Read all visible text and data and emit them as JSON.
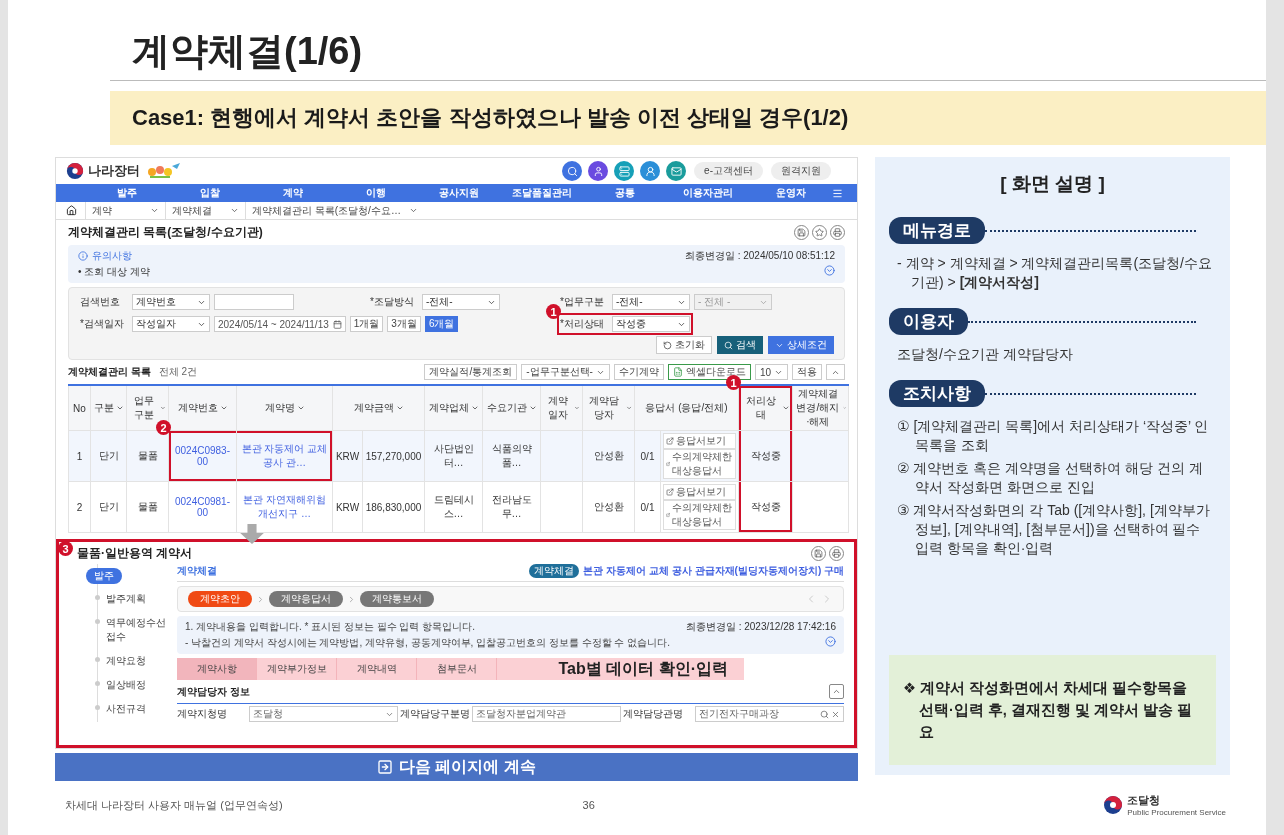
{
  "slide": {
    "title": "계약체결(1/6)",
    "case_title": "Case1: 현행에서 계약서 초안을 작성하였으나 발송 이전 상태일 경우(1/2)"
  },
  "app": {
    "logo": "나라장터",
    "header_buttons": [
      "e-고객센터",
      "원격지원"
    ],
    "nav": [
      "발주",
      "입찰",
      "계약",
      "이행",
      "공사지원",
      "조달품질관리",
      "공통",
      "이용자관리",
      "운영자"
    ],
    "breadcrumb": [
      "계약",
      "계약체결",
      "계약체결관리 목록(조달청/수요…"
    ],
    "page_title": "계약체결관리 목록(조달청/수요기관)",
    "notice": {
      "title": "유의사항",
      "item": "• 조회 대상 계약",
      "updated": "최종변경일 : 2024/05/10 08:51:12"
    },
    "search": {
      "fields": [
        {
          "label": "검색번호",
          "highlighted": false,
          "controls": [
            {
              "kind": "select",
              "value": "계약번호",
              "disabled": false
            },
            {
              "kind": "input"
            }
          ]
        },
        {
          "label": "*조달방식",
          "highlighted": false,
          "controls": [
            {
              "kind": "select",
              "value": "-전체-",
              "disabled": false
            }
          ]
        },
        {
          "label": "*업무구분",
          "highlighted": false,
          "controls": [
            {
              "kind": "select",
              "value": "-전체-",
              "disabled": false
            },
            {
              "kind": "select",
              "value": "- 전체 -",
              "disabled": true
            }
          ]
        },
        {
          "label": "*검색일자",
          "highlighted": false,
          "controls": [
            {
              "kind": "select",
              "value": "작성일자",
              "disabled": false
            },
            {
              "kind": "daterange",
              "value": "2024/05/14 ~ 2024/11/13"
            },
            {
              "kind": "period",
              "options": [
                {
                  "label": "1개월",
                  "selected": false
                },
                {
                  "label": "3개월",
                  "selected": false
                },
                {
                  "label": "6개월",
                  "selected": true
                }
              ]
            }
          ]
        },
        {
          "label": "*처리상태",
          "highlighted": true,
          "marker": "1",
          "controls": [
            {
              "kind": "select",
              "value": "작성중",
              "disabled": false
            }
          ]
        }
      ],
      "buttons": [
        {
          "kind": "reset",
          "label": "초기화"
        },
        {
          "kind": "search",
          "label": "검색"
        },
        {
          "kind": "detail",
          "label": "상세조건"
        }
      ]
    },
    "list": {
      "title": "계약체결관리 목록",
      "count": "전체 2건",
      "tools": [
        {
          "kind": "button",
          "label": "계약실적/통계조회"
        },
        {
          "kind": "select",
          "label": "-업무구분선택-"
        },
        {
          "kind": "button",
          "label": "수기계약"
        },
        {
          "kind": "excel",
          "label": "엑셀다운로드"
        },
        {
          "kind": "select",
          "label": "10"
        },
        {
          "kind": "button",
          "label": "적용"
        },
        {
          "kind": "collapse"
        }
      ],
      "columns": [
        {
          "label": "No",
          "kind": "text",
          "filter": false,
          "highlighted": false
        },
        {
          "label": "구분",
          "kind": "text",
          "filter": true,
          "highlighted": false
        },
        {
          "label": "업무구분",
          "kind": "text",
          "filter": true,
          "highlighted": false
        },
        {
          "label": "계약번호",
          "kind": "text",
          "filter": true,
          "highlighted": false
        },
        {
          "label": "계약명",
          "kind": "text",
          "filter": true,
          "highlighted": false
        },
        {
          "label": "계약금액",
          "kind": "money",
          "filter": true,
          "highlighted": false
        },
        {
          "label": "계약업체",
          "kind": "text",
          "filter": true,
          "highlighted": false
        },
        {
          "label": "수요기관",
          "kind": "text",
          "filter": true,
          "highlighted": false
        },
        {
          "label": "계약일자",
          "kind": "text",
          "filter": true,
          "highlighted": false
        },
        {
          "label": "계약담당자",
          "kind": "text",
          "filter": true,
          "highlighted": false
        },
        {
          "label": "응답서 (응답/전체)",
          "kind": "response",
          "filter": false,
          "highlighted": false
        },
        {
          "label": "처리상태",
          "kind": "text",
          "filter": true,
          "highlighted": true,
          "marker": "1"
        },
        {
          "label": "계약체결 변경/해지·해제",
          "kind": "text",
          "filter": true,
          "highlighted": false
        }
      ],
      "rows": [
        {
          "selected": true,
          "highlighted": true,
          "marker": "2",
          "no": "1",
          "type": "단기",
          "biz": "물품",
          "number": "0024C0983-00",
          "name": "본관 자동제어 교체 공사 관…",
          "currency": "KRW",
          "amount": "157,270,000",
          "vendor": "사단법인 터…",
          "agency": "식품의약품…",
          "manager": "안성환",
          "response": "0/1",
          "links": [
            "응답서보기",
            "수의계약체한 대상응답서"
          ],
          "status": "작성중"
        },
        {
          "selected": false,
          "highlighted": false,
          "no": "2",
          "type": "단기",
          "biz": "물품",
          "number": "0024C0981-00",
          "name": "본관 자연재해위험개선지구 …",
          "currency": "KRW",
          "amount": "186,830,000",
          "vendor": "드림테시스…",
          "agency": "전라남도 무…",
          "manager": "안성환",
          "response": "0/1",
          "links": [
            "응답서보기",
            "수의계약체한 대상응답서"
          ],
          "status": "작성중"
        }
      ]
    },
    "contract": {
      "marker": "3",
      "title": "물품·일반용역 계약서",
      "steps_group": "발주",
      "steps": [
        "발주계획",
        "역무예정수선접수",
        "계약요청",
        "일상배정",
        "사전규격"
      ],
      "heading": "계약체결",
      "badge": "계약체결",
      "subject": "본관 자동제어 교체 공사 관급자재(빌딩자동제어장치) 구매",
      "progress": [
        {
          "label": "계약초안",
          "selected": true
        },
        {
          "label": "계약응답서",
          "selected": false
        },
        {
          "label": "계약통보서",
          "selected": false
        }
      ],
      "info": [
        "1. 계약내용을 입력합니다. * 표시된 정보는 필수 입력 항목입니다.",
        "- 낙찰건의 계약서 작성시에는 계약방법, 계약유형, 공동계약여부, 입찰공고번호의 정보를 수정할 수 없습니다."
      ],
      "updated": "최종변경일 : 2023/12/28 17:42:16",
      "tabs": [
        {
          "label": "계약사항",
          "selected": true
        },
        {
          "label": "계약부가정보",
          "selected": false
        },
        {
          "label": "계약내역",
          "selected": false
        },
        {
          "label": "첨부문서",
          "selected": false
        }
      ],
      "tab_hint": "Tab별 데이터 확인·입력",
      "section": "계약담당자 정보",
      "fields": [
        {
          "label": "계약지청명",
          "kind": "select",
          "value": "조달청"
        },
        {
          "label": "계약담당구분명",
          "kind": "input",
          "value": "조달청자분업계약관"
        },
        {
          "label": "계약담당관명",
          "kind": "search",
          "value": "전기전자구매과장"
        }
      ]
    }
  },
  "continue": "다음 페이지에 계속",
  "explain": {
    "title": "[ 화면 설명 ]",
    "sections": [
      {
        "label": "메뉴경로",
        "kind": "path",
        "text": "- 계약 > 계약체결 > 계약체결관리목록(조달청/수요기관) > **[계약서작성]**"
      },
      {
        "label": "이용자",
        "kind": "text",
        "text": "조달청/수요기관 계약담당자"
      },
      {
        "label": "조치사항",
        "kind": "list",
        "items": [
          "① [계약체결관리 목록]에서 처리상태가 ‘작성중’ 인 목록을 조회",
          "② 계약번호 혹은 계약명을 선택하여 해당 건의 계약서 작성화면 화면으로 진입",
          "③ 계약서작성화면의 각 Tab ([계약사항], [계약부가정보], [계약내역], [첨부문서])을 선택하여 필수 입력 항목을 확인·입력"
        ]
      }
    ],
    "note": "❖ 계약서 작성화면에서 차세대 필수항목을 선택·입력 후, 결재진행 및 계약서 발송 필요"
  },
  "footer": {
    "manual": "차세대 나라장터 사용자 매뉴얼 (업무연속성)",
    "page": "36",
    "org": "조달청",
    "org_en": "Public Procurement Service"
  }
}
